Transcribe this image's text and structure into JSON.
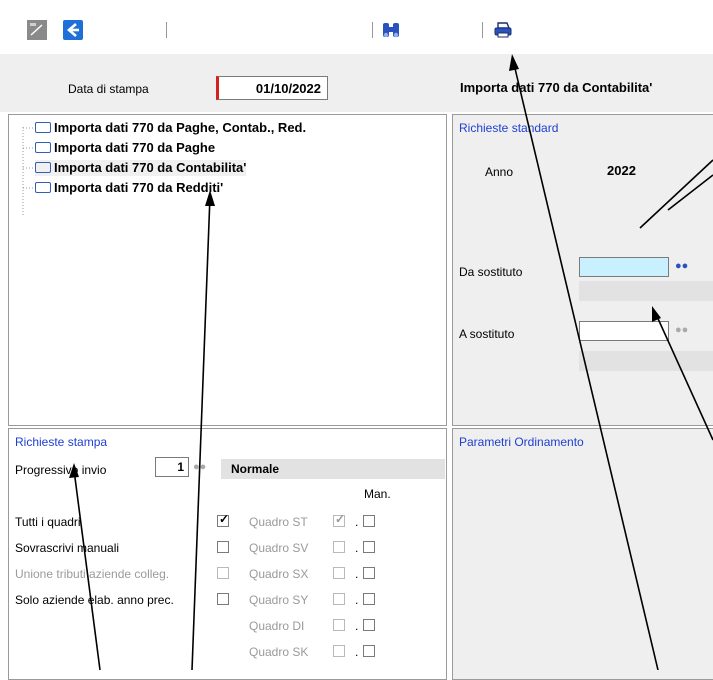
{
  "toolbar": {
    "icons": [
      "document-icon",
      "back-arrow-icon",
      "binoculars-icon",
      "printer-icon"
    ]
  },
  "header": {
    "print_date_label": "Data di stampa",
    "print_date_value": "01/10/2022",
    "title": "Importa dati 770 da Contabilita'"
  },
  "tree": {
    "items": [
      {
        "label": "Importa dati 770 da Paghe, Contab., Red."
      },
      {
        "label": "Importa dati 770 da Paghe"
      },
      {
        "label": "Importa dati 770 da Contabilita'"
      },
      {
        "label": "Importa dati 770 da Redditi'"
      }
    ]
  },
  "standard": {
    "header": "Richieste standard",
    "anno_label": "Anno",
    "anno_value": "2022",
    "da_label": "Da sostituto",
    "da_value": "",
    "a_label": "A sostituto",
    "a_value": ""
  },
  "stampa": {
    "header": "Richieste stampa",
    "prog_label": "Progressivo invio",
    "prog_value": "1",
    "prog_status": "Normale",
    "man_label": "Man.",
    "rows": [
      {
        "label": "Tutti i quadri",
        "checked": true,
        "disabled": false
      },
      {
        "label": "Sovrascrivi manuali",
        "checked": false,
        "disabled": false
      },
      {
        "label": "Unione tributi aziende colleg.",
        "checked": false,
        "disabled": true
      },
      {
        "label": "Solo aziende elab. anno prec.",
        "checked": false,
        "disabled": false
      }
    ],
    "quadri": [
      {
        "label": "Quadro ST",
        "checked": true,
        "man_sep": "."
      },
      {
        "label": "Quadro SV",
        "checked": false,
        "man_sep": "."
      },
      {
        "label": "Quadro SX",
        "checked": false,
        "man_sep": "."
      },
      {
        "label": "Quadro SY",
        "checked": false,
        "man_sep": "."
      },
      {
        "label": "Quadro DI",
        "checked": false,
        "man_sep": "."
      },
      {
        "label": "Quadro SK",
        "checked": false,
        "man_sep": "."
      }
    ]
  },
  "ordinamento": {
    "header": "Parametri Ordinamento"
  },
  "colors": {
    "accent_blue": "#1e3fd0",
    "highlight_field": "#c8f0ff",
    "date_marker": "#d42020"
  }
}
